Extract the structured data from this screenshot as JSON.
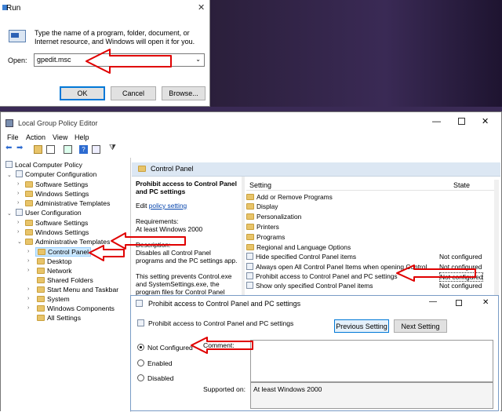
{
  "run": {
    "title": "Run",
    "description": "Type the name of a program, folder, document, or Internet resource, and Windows will open it for you.",
    "open_label": "Open:",
    "open_value": "gpedit.msc",
    "ok": "OK",
    "cancel": "Cancel",
    "browse": "Browse..."
  },
  "gpe": {
    "title": "Local Group Policy Editor",
    "menu": [
      "File",
      "Action",
      "View",
      "Help"
    ],
    "tree": {
      "root": "Local Computer Policy",
      "computer_configuration": "Computer Configuration",
      "cc_software": "Software Settings",
      "cc_windows": "Windows Settings",
      "cc_admin": "Administrative Templates",
      "user_configuration": "User Configuration",
      "uc_software": "Software Settings",
      "uc_windows": "Windows Settings",
      "uc_admin": "Administrative Templates",
      "control_panel": "Control Panel",
      "desktop": "Desktop",
      "network": "Network",
      "shared_folders": "Shared Folders",
      "start_menu": "Start Menu and Taskbar",
      "system": "System",
      "windows_components": "Windows Components",
      "all_settings": "All Settings"
    },
    "pane_header": "Control Panel",
    "desc_title": "Prohibit access to Control Panel and PC settings",
    "desc_edit": "Edit",
    "desc_link": "policy setting",
    "desc_req_label": "Requirements:",
    "desc_req_value": "At least Windows 2000",
    "desc_description_label": "Description:",
    "desc_text1": "Disables all Control Panel programs and the PC settings app.",
    "desc_text2": "This setting prevents Control.exe and SystemSettings.exe, the program files for Control Panel",
    "col_setting": "Setting",
    "col_state": "State",
    "rows": [
      {
        "name": "Add or Remove Programs",
        "state": "",
        "kind": "folder"
      },
      {
        "name": "Display",
        "state": "",
        "kind": "folder"
      },
      {
        "name": "Personalization",
        "state": "",
        "kind": "folder"
      },
      {
        "name": "Printers",
        "state": "",
        "kind": "folder"
      },
      {
        "name": "Programs",
        "state": "",
        "kind": "folder"
      },
      {
        "name": "Regional and Language Options",
        "state": "",
        "kind": "folder"
      },
      {
        "name": "Hide specified Control Panel items",
        "state": "Not configured",
        "kind": "policy"
      },
      {
        "name": "Always open All Control Panel Items when opening Control ...",
        "state": "Not configured",
        "kind": "policy"
      },
      {
        "name": "Prohibit access to Control Panel and PC settings",
        "state": "Not configured",
        "kind": "policy"
      },
      {
        "name": "Show only specified Control Panel items",
        "state": "Not configured",
        "kind": "policy"
      }
    ]
  },
  "dialog": {
    "title": "Prohibit access to Control Panel and PC settings",
    "heading": "Prohibit access to Control Panel and PC settings",
    "previous": "Previous Setting",
    "next": "Next Setting",
    "not_configured": "Not Configured",
    "enabled": "Enabled",
    "disabled": "Disabled",
    "comment_label": "Comment:",
    "supported_label": "Supported on:",
    "supported_value": "At least Windows 2000"
  },
  "colors": {
    "accent": "#0078d7",
    "arrow": "#e00000",
    "selection": "#cce8ff"
  }
}
